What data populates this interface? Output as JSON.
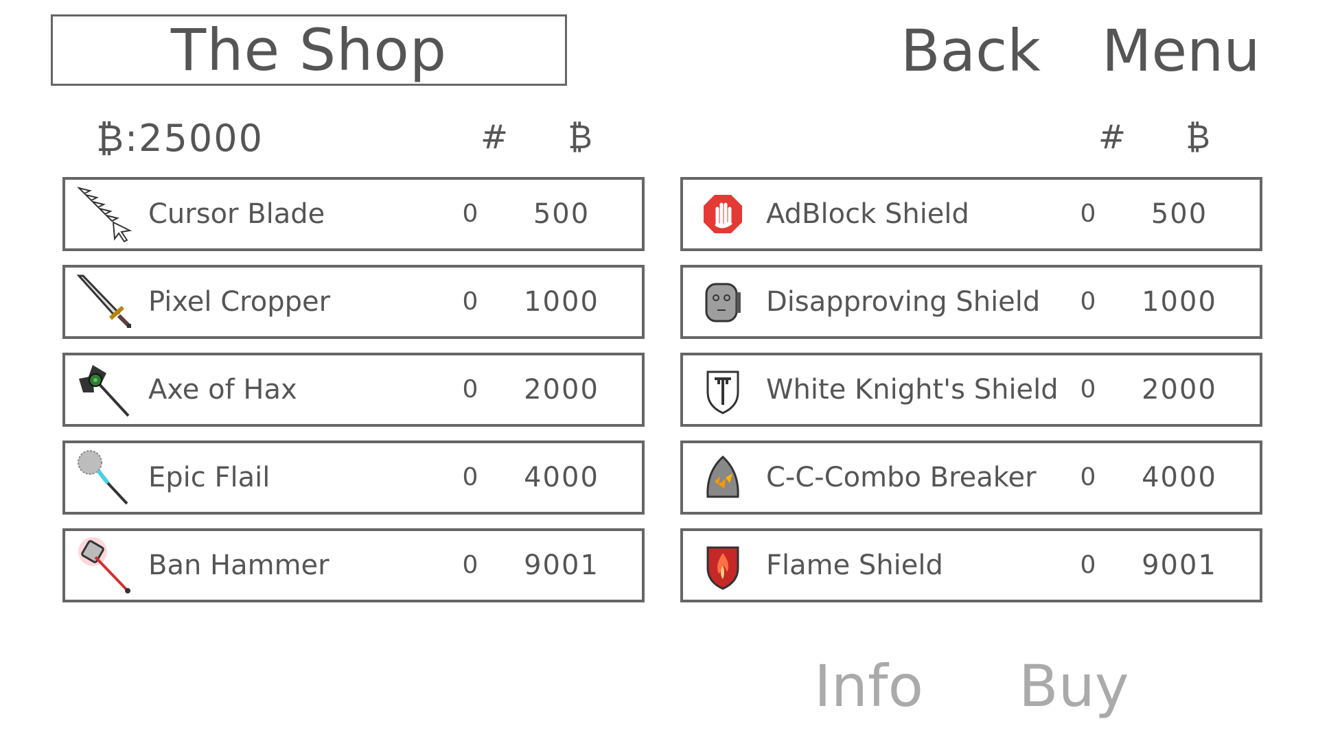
{
  "header": {
    "title": "The Shop",
    "back_label": "Back",
    "menu_label": "Menu"
  },
  "currency": {
    "symbol": "₿",
    "balance_text": "₿:25000"
  },
  "columns": {
    "qty_header": "#",
    "price_header": "₿"
  },
  "weapons": [
    {
      "name": "Cursor Blade",
      "qty": "0",
      "price": "500",
      "icon": "cursor-blade-icon"
    },
    {
      "name": "Pixel Cropper",
      "qty": "0",
      "price": "1000",
      "icon": "pixel-sword-icon"
    },
    {
      "name": "Axe of Hax",
      "qty": "0",
      "price": "2000",
      "icon": "axe-icon"
    },
    {
      "name": "Epic Flail",
      "qty": "0",
      "price": "4000",
      "icon": "flail-icon"
    },
    {
      "name": "Ban Hammer",
      "qty": "0",
      "price": "9001",
      "icon": "hammer-icon"
    }
  ],
  "shields": [
    {
      "name": "AdBlock Shield",
      "qty": "0",
      "price": "500",
      "icon": "stop-hand-icon"
    },
    {
      "name": "Disapproving Shield",
      "qty": "0",
      "price": "1000",
      "icon": "face-shield-icon"
    },
    {
      "name": "White Knight's Shield",
      "qty": "0",
      "price": "2000",
      "icon": "knight-shield-icon"
    },
    {
      "name": "C-C-Combo Breaker",
      "qty": "0",
      "price": "4000",
      "icon": "combo-shield-icon"
    },
    {
      "name": "Flame Shield",
      "qty": "0",
      "price": "9001",
      "icon": "flame-shield-icon"
    }
  ],
  "actions": {
    "info_label": "Info",
    "buy_label": "Buy"
  },
  "colors": {
    "text": "#555555",
    "border": "#666666",
    "disabled": "#aaaaaa",
    "adblock_red": "#e53935",
    "flame_red": "#c62828"
  }
}
